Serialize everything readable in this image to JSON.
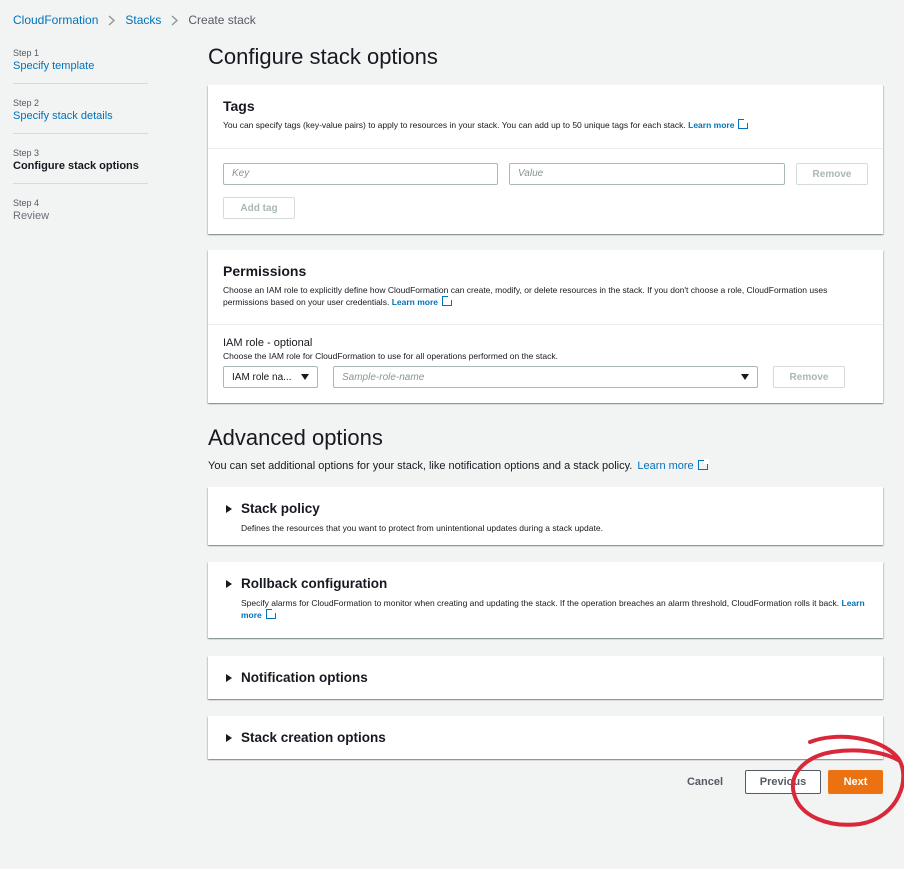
{
  "breadcrumb": [
    "CloudFormation",
    "Stacks",
    "Create stack"
  ],
  "steps": [
    {
      "num": "Step 1",
      "title": "Specify template"
    },
    {
      "num": "Step 2",
      "title": "Specify stack details"
    },
    {
      "num": "Step 3",
      "title": "Configure stack options"
    },
    {
      "num": "Step 4",
      "title": "Review"
    }
  ],
  "page_title": "Configure stack options",
  "tags": {
    "title": "Tags",
    "description": "You can specify tags (key-value pairs) to apply to resources in your stack. You can add up to 50 unique tags for each stack.",
    "learn_more": "Learn more",
    "key_placeholder": "Key",
    "value_placeholder": "Value",
    "remove_label": "Remove",
    "add_tag_label": "Add tag"
  },
  "permissions": {
    "title": "Permissions",
    "description": "Choose an IAM role to explicitly define how CloudFormation can create, modify, or delete resources in the stack. If you don't choose a role, CloudFormation uses permissions based on your user credentials.",
    "learn_more": "Learn more",
    "iam_label": "IAM role - optional",
    "iam_hint": "Choose the IAM role for CloudFormation to use for all operations performed on the stack.",
    "role_type_selected": "IAM role na...",
    "role_placeholder": "Sample-role-name",
    "remove_label": "Remove"
  },
  "advanced": {
    "title": "Advanced options",
    "description": "You can set additional options for your stack, like notification options and a stack policy.",
    "learn_more": "Learn more",
    "sections": [
      {
        "title": "Stack policy",
        "description": "Defines the resources that you want to protect from unintentional updates during a stack update."
      },
      {
        "title": "Rollback configuration",
        "description": "Specify alarms for CloudFormation to monitor when creating and updating the stack. If the operation breaches an alarm threshold, CloudFormation rolls it back.",
        "learn_more": "Learn more"
      },
      {
        "title": "Notification options"
      },
      {
        "title": "Stack creation options"
      }
    ]
  },
  "actions": {
    "cancel": "Cancel",
    "previous": "Previous",
    "next": "Next"
  },
  "colors": {
    "link": "#0073bb",
    "primary": "#ec7211",
    "background": "#f2f3f3",
    "annotation": "#d9283a"
  },
  "icons": {
    "breadcrumb_separator": "chevron-right-icon",
    "external_link": "external-link-icon",
    "expand": "caret-right-icon",
    "dropdown": "caret-down-icon"
  }
}
